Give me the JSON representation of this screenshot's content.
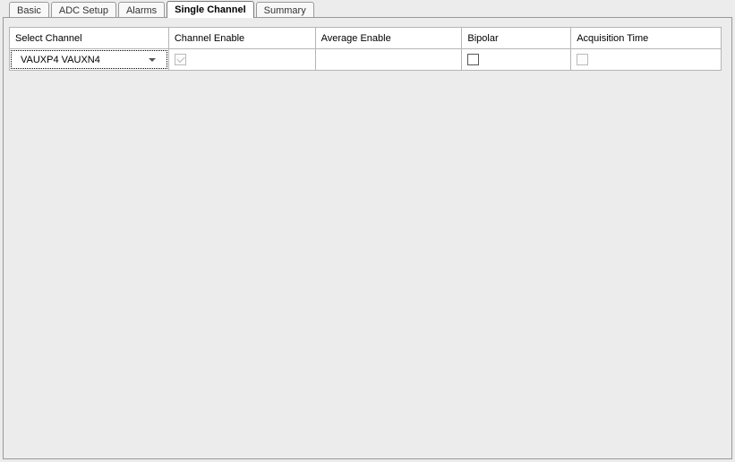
{
  "tabs": [
    {
      "label": "Basic",
      "active": false
    },
    {
      "label": "ADC Setup",
      "active": false
    },
    {
      "label": "Alarms",
      "active": false
    },
    {
      "label": "Single Channel",
      "active": true
    },
    {
      "label": "Summary",
      "active": false
    }
  ],
  "columns": {
    "select_channel": "Select Channel",
    "channel_enable": "Channel Enable",
    "average_enable": "Average Enable",
    "bipolar": "Bipolar",
    "acquisition_time": "Acquisition Time"
  },
  "row": {
    "selected_channel": "VAUXP4 VAUXN4",
    "channel_enable": {
      "checked": true,
      "disabled": true
    },
    "average_enable": {
      "highlighted": true
    },
    "bipolar": {
      "checked": false,
      "disabled": false
    },
    "acquisition_time": {
      "checked": false,
      "disabled": true
    }
  }
}
